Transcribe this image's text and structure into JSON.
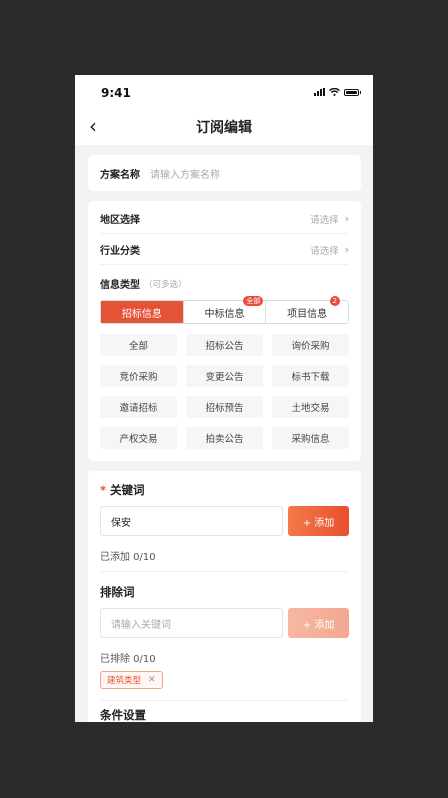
{
  "status_bar": {
    "time": "9:41",
    "icons": [
      "signal-icon",
      "wifi-icon",
      "battery-icon"
    ]
  },
  "nav": {
    "back_icon": "chevron-left-icon",
    "title": "订阅编辑"
  },
  "plan": {
    "label": "方案名称",
    "placeholder": "请输入方案名称"
  },
  "region": {
    "label": "地区选择",
    "value": "请选择",
    "icon": "chevron-right-icon"
  },
  "industry": {
    "label": "行业分类",
    "value": "请选择",
    "icon": "chevron-right-icon"
  },
  "info_type": {
    "label": "信息类型",
    "hint": "（可多选）",
    "tabs": [
      {
        "label": "招标信息",
        "badge": ""
      },
      {
        "label": "中标信息",
        "badge": "全部"
      },
      {
        "label": "项目信息",
        "badge": "2"
      }
    ],
    "options": [
      "全部",
      "招标公告",
      "询价采购",
      "竞价采购",
      "变更公告",
      "标书下载",
      "邀请招标",
      "招标预告",
      "土地交易",
      "产权交易",
      "拍卖公告",
      "采购信息"
    ]
  },
  "keywords": {
    "required_mark": "*",
    "label": "关键词",
    "value": "保安",
    "add_label": "+ 添加",
    "count": "已添加   0/10"
  },
  "exclude": {
    "label": "排除词",
    "placeholder": "请输入关键词",
    "add_label": "+ 添加",
    "count": "已排除   0/10",
    "chips": [
      {
        "label": "建筑类型",
        "close_icon": "close-icon"
      }
    ]
  },
  "conditions": {
    "label": "条件设置"
  },
  "colors": {
    "accent": "#e55337",
    "accent_light": "#f3a890",
    "background": "#f2f3f5"
  }
}
